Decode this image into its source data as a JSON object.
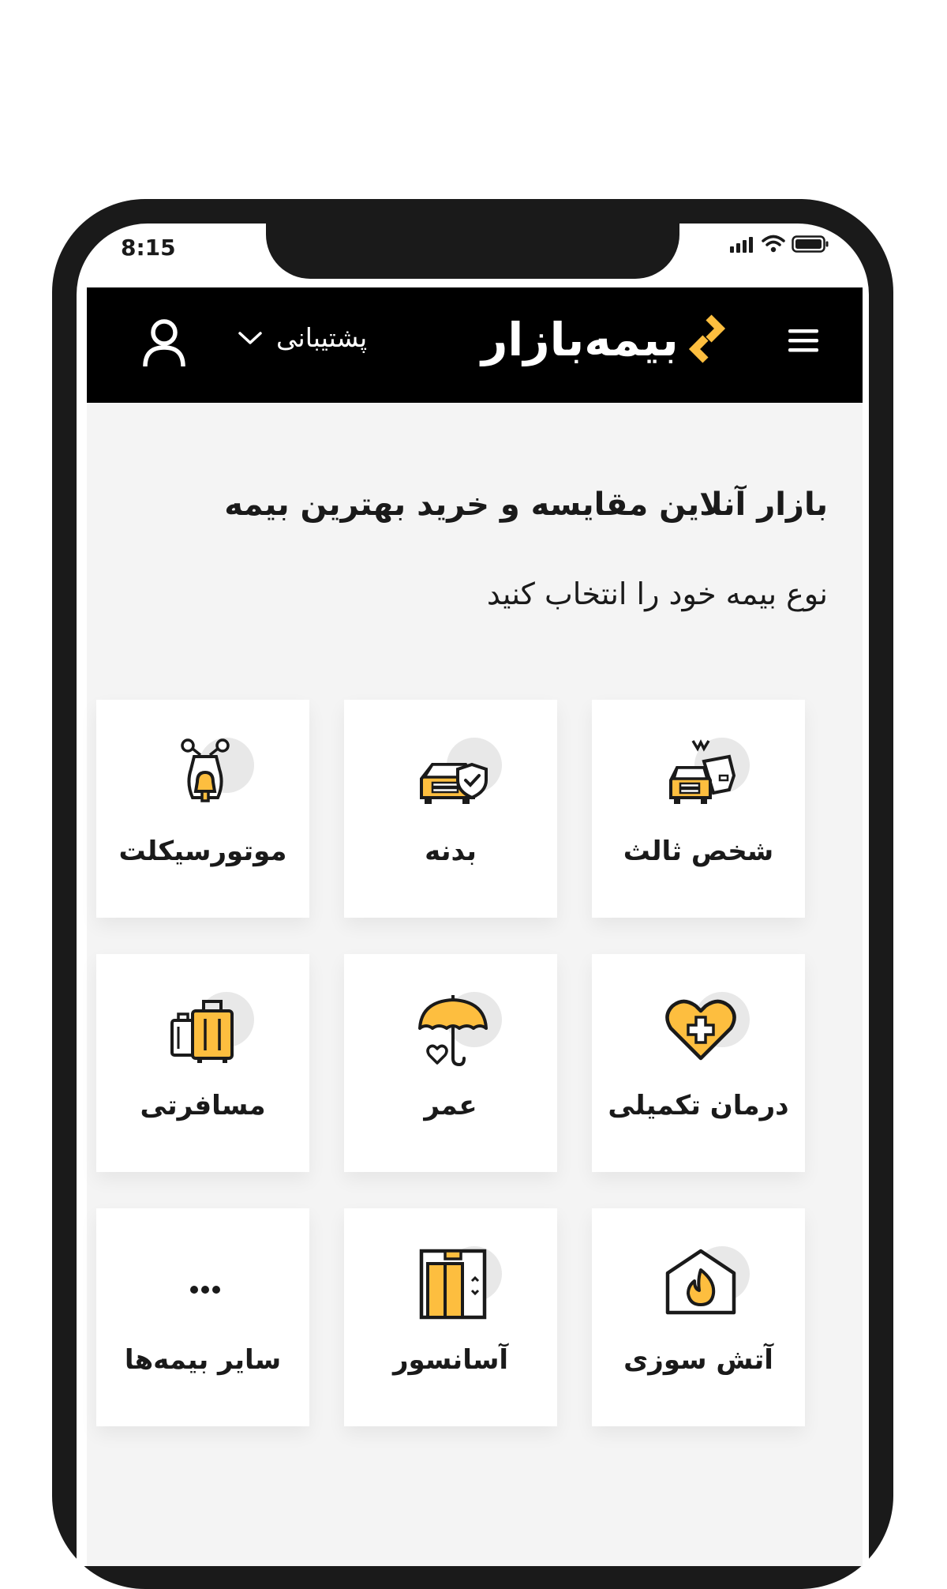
{
  "status_bar": {
    "time": "8:15"
  },
  "header": {
    "brand": "بیمه‌بازار",
    "support_label": "پشتیبانی"
  },
  "main": {
    "headline": "بازار آنلاین مقایسه و خرید بهترین بیمه",
    "subheadline": "نوع بیمه خود را انتخاب کنید",
    "cards": [
      {
        "label": "شخص ثالث",
        "icon": "third-party-car-crash-icon"
      },
      {
        "label": "بدنه",
        "icon": "car-body-shield-icon"
      },
      {
        "label": "موتورسیکلت",
        "icon": "motorcycle-icon"
      },
      {
        "label": "درمان تکمیلی",
        "icon": "heart-medical-icon"
      },
      {
        "label": "عمر",
        "icon": "umbrella-heart-icon"
      },
      {
        "label": "مسافرتی",
        "icon": "luggage-icon"
      },
      {
        "label": "آتش سوزی",
        "icon": "house-fire-icon"
      },
      {
        "label": "آسانسور",
        "icon": "elevator-icon"
      },
      {
        "label": "سایر بیمه‌ها",
        "icon": "more-dots-icon"
      }
    ]
  },
  "colors": {
    "accent": "#FDBE3F",
    "header_bg": "#000000",
    "content_bg": "#F4F4F4"
  }
}
